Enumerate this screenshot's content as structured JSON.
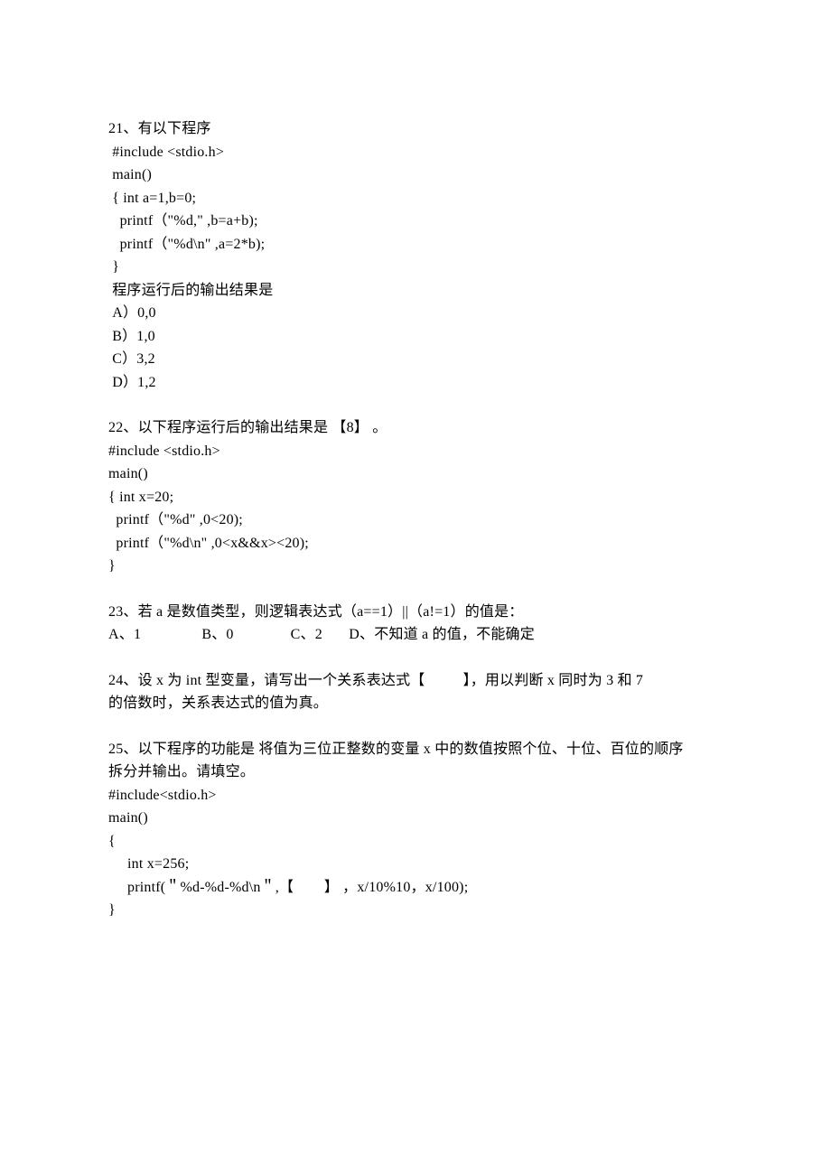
{
  "q21": {
    "line1": "21、有以下程序",
    "line2": " #include <stdio.h>",
    "line3": " main()",
    "line4": " { int a=1,b=0;",
    "line5": "   printf（\"%d,\" ,b=a+b);",
    "line6": "   printf（\"%d\\n\" ,a=2*b);",
    "line7": " }",
    "line8": " 程序运行后的输出结果是",
    "optA": " A）0,0",
    "optB": " B）1,0",
    "optC": " C）3,2",
    "optD": " D）1,2"
  },
  "q22": {
    "line1": "22、以下程序运行后的输出结果是 【8】 。",
    "line2": "#include <stdio.h>",
    "line3": "main()",
    "line4": "{ int x=20;",
    "line5": "  printf（\"%d\" ,0<20);",
    "line6": "  printf（\"%d\\n\" ,0<x&&x><20);",
    "line7": "}"
  },
  "q23": {
    "line1": "23、若 a 是数值类型，则逻辑表达式（a==1）||（a!=1）的值是：",
    "line2": "A、1                B、0               C、2       D、不知道 a 的值，不能确定"
  },
  "q24": {
    "line1": "24、设 x 为 int 型变量，请写出一个关系表达式【          】，用以判断 x 同时为 3 和 7",
    "line2": "的倍数时，关系表达式的值为真。"
  },
  "q25": {
    "line1": "25、以下程序的功能是 将值为三位正整数的变量 x 中的数值按照个位、十位、百位的顺序",
    "line2": "拆分并输出。请填空。",
    "line3": "#include<stdio.h>",
    "line4": "main()",
    "line5": "{",
    "line6": "     int x=256;",
    "line7": "     printf(＂%d-%d-%d\\n＂,【        】 ，x/10%10，x/100);",
    "line8": "}"
  }
}
